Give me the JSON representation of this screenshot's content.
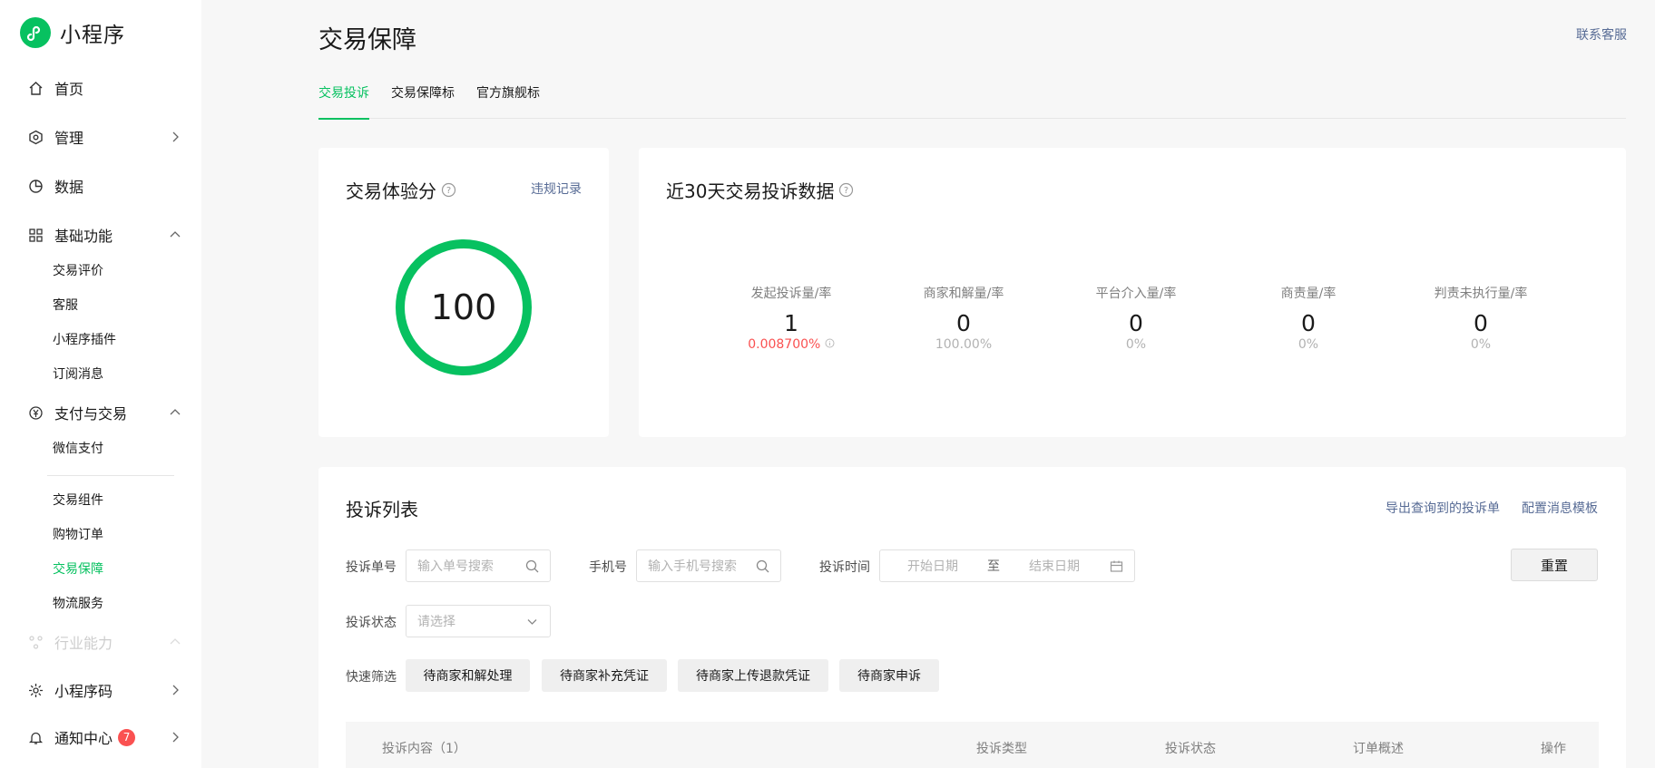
{
  "brand": {
    "title": "小程序"
  },
  "sidebar": {
    "home": "首页",
    "manage": "管理",
    "data": "数据",
    "basic": "基础功能",
    "basic_items": [
      "交易评价",
      "客服",
      "小程序插件",
      "订阅消息"
    ],
    "payment": "支付与交易",
    "payment_items": [
      "微信支付",
      "交易组件",
      "购物订单",
      "交易保障",
      "物流服务"
    ],
    "industry": "行业能力",
    "qrcode": "小程序码",
    "notify": "通知中心",
    "notify_badge": "7"
  },
  "header": {
    "title": "交易保障",
    "contact": "联系客服"
  },
  "tabs": [
    "交易投诉",
    "交易保障标",
    "官方旗舰标"
  ],
  "score_card": {
    "title": "交易体验分",
    "link": "违规记录",
    "score": "100"
  },
  "stats_card": {
    "title": "近30天交易投诉数据",
    "stats": [
      {
        "label": "发起投诉量/率",
        "value": "1",
        "rate": "0.008700%"
      },
      {
        "label": "商家和解量/率",
        "value": "0",
        "rate": "100.00%"
      },
      {
        "label": "平台介入量/率",
        "value": "0",
        "rate": "0%"
      },
      {
        "label": "商责量/率",
        "value": "0",
        "rate": "0%"
      },
      {
        "label": "判责未执行量/率",
        "value": "0",
        "rate": "0%"
      }
    ]
  },
  "list_card": {
    "title": "投诉列表",
    "export": "导出查询到的投诉单",
    "config": "配置消息模板",
    "order_label": "投诉单号",
    "order_placeholder": "输入单号搜索",
    "phone_label": "手机号",
    "phone_placeholder": "输入手机号搜索",
    "time_label": "投诉时间",
    "start_placeholder": "开始日期",
    "to": "至",
    "end_placeholder": "结束日期",
    "reset": "重置",
    "status_label": "投诉状态",
    "status_placeholder": "请选择",
    "quick_label": "快速筛选",
    "quick_filters": [
      "待商家和解处理",
      "待商家补充凭证",
      "待商家上传退款凭证",
      "待商家申诉"
    ],
    "columns": [
      "投诉内容（1）",
      "投诉类型",
      "投诉状态",
      "订单概述",
      "操作"
    ]
  },
  "colors": {
    "accent": "#07c160",
    "link": "#576b95",
    "danger": "#fa5151"
  }
}
